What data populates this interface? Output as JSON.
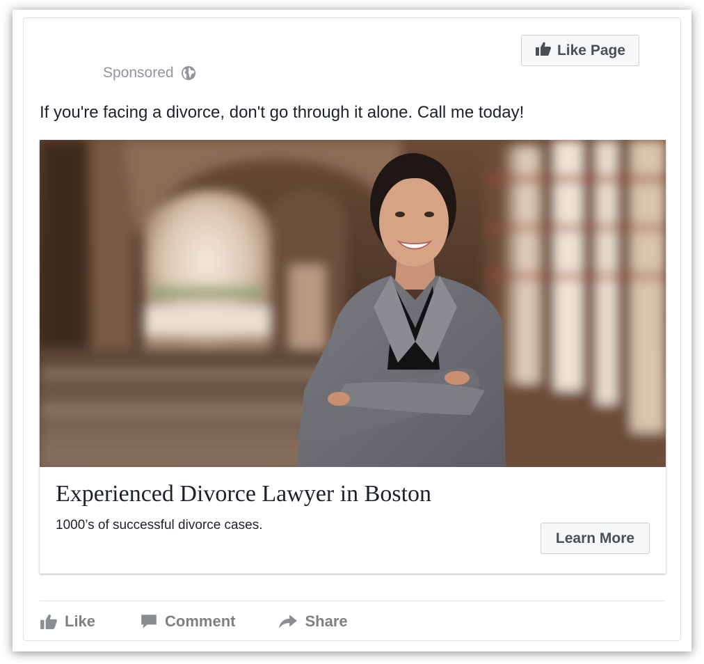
{
  "header": {
    "like_page_label": "Like Page",
    "sponsored_label": "Sponsored"
  },
  "post": {
    "text": "If you're facing a divorce, don't go through it alone. Call me today!"
  },
  "ad": {
    "headline": "Experienced Divorce Lawyer in Boston",
    "description": "1000’s of successful divorce cases.",
    "cta_label": "Learn More"
  },
  "actions": {
    "like_label": "Like",
    "comment_label": "Comment",
    "share_label": "Share"
  },
  "icons": {
    "like_page": "thumbs-up-icon",
    "sponsored": "globe-icon",
    "like": "thumbs-up-icon",
    "comment": "speech-bubble-icon",
    "share": "share-arrow-icon"
  },
  "colors": {
    "button_bg": "#f6f7f9",
    "button_border": "#ccd0d5",
    "muted_text": "#90949c",
    "action_text": "#7f7f7f",
    "body_text": "#1d2129"
  }
}
